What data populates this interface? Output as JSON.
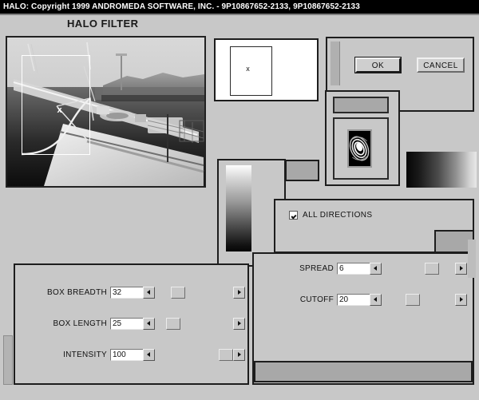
{
  "window": {
    "title": "HALO: Copyright 1999 ANDROMEDA SOFTWARE, INC. - 9P10867652-2133, 9P10867652-2133",
    "heading": "HALO FILTER",
    "background_color": "#c8c8c8",
    "titlebar_color": "#000000",
    "titlebar_text_color": "#ffffff"
  },
  "preview": {
    "name": "image-preview",
    "selection_marker": "x",
    "description": "grayscale foggy harbour photo with white selection rectangle"
  },
  "thumbnail": {
    "name": "halo-position-thumbnail",
    "marker": "x",
    "background_color": "#ffffff"
  },
  "halo_preview": {
    "name": "halo-shape-preview",
    "description": "spiral halo flare thumbnail on black"
  },
  "buttons": {
    "ok": "OK",
    "cancel": "CANCEL"
  },
  "options": {
    "all_directions": {
      "label": "ALL DIRECTIONS",
      "checked": true
    }
  },
  "params_left": [
    {
      "label": "BOX BREADTH",
      "value": "32"
    },
    {
      "label": "BOX LENGTH",
      "value": "25"
    },
    {
      "label": "INTENSITY",
      "value": "100"
    }
  ],
  "params_right": [
    {
      "label": "SPREAD",
      "value": "6"
    },
    {
      "label": "CUTOFF",
      "value": "20"
    }
  ],
  "gradients": {
    "vertical": "white-to-black vertical ramp",
    "horizontal": "black-to-white horizontal ramp"
  }
}
